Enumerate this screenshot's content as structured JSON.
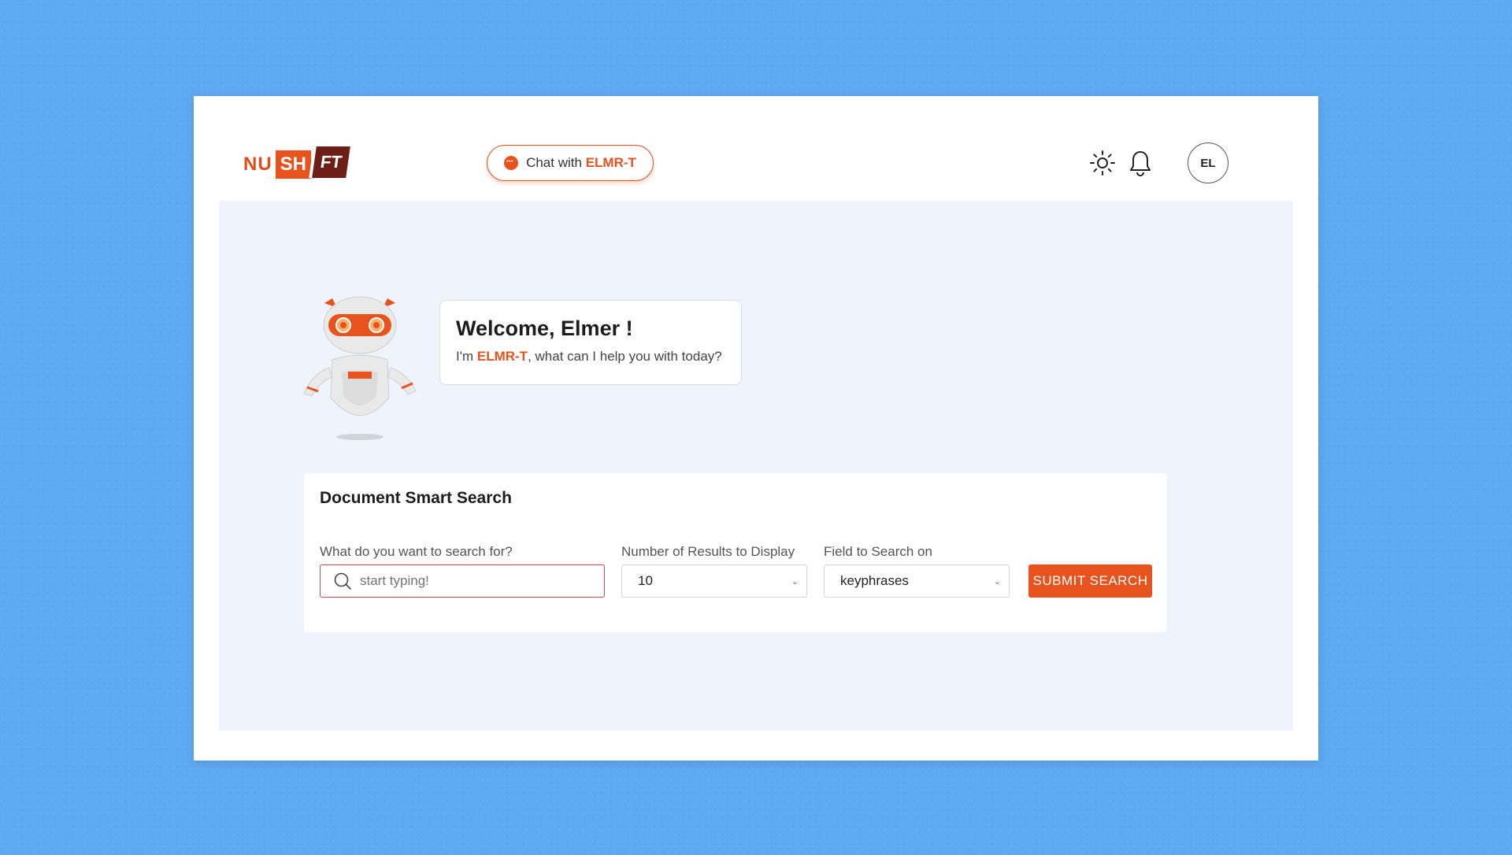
{
  "header": {
    "logo": {
      "part1": "NU",
      "part2": "SH",
      "part3": "FT"
    },
    "chat_button": {
      "prefix": "Chat with",
      "accent": "ELMR-T"
    },
    "icons": [
      "sun-icon",
      "bell-icon"
    ],
    "avatar_initials": "EL"
  },
  "welcome": {
    "title": "Welcome, Elmer !",
    "sub_prefix": "I'm ",
    "sub_accent": "ELMR-T",
    "sub_suffix": ", what can I help you with today?"
  },
  "search": {
    "title": "Document Smart Search",
    "query_label": "What do you want to search for?",
    "query_placeholder": "start typing!",
    "results_label": "Number of Results to Display",
    "results_value": "10",
    "field_label": "Field to Search on",
    "field_value": "keyphrases",
    "submit_label": "SUBMIT SEARCH"
  },
  "colors": {
    "accent": "#e8521c",
    "background": "#5fa8f2",
    "panel": "#eef3fc"
  }
}
